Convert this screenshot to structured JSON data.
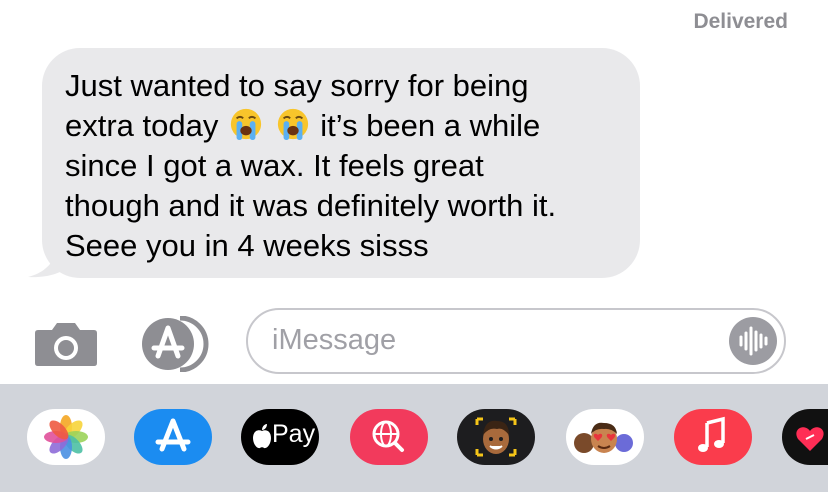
{
  "thread": {
    "status": "Delivered",
    "message": {
      "lines": [
        "Just wanted to say sorry for being",
        "extra today",
        "it’s been a while",
        "since I got a wax. It feels great",
        "though and it was definitely worth it.",
        "Seee you in 4 weeks sisss"
      ],
      "emoji": [
        "crying-face",
        "crying-face"
      ]
    }
  },
  "composer": {
    "placeholder": "iMessage",
    "camera_icon": "camera-icon",
    "apps_icon": "app-store-icon",
    "audio_icon": "audio-waveform-icon"
  },
  "app_drawer": {
    "apple_pay_label": "Pay",
    "apps": [
      "photos",
      "app-store",
      "apple-pay",
      "web-search",
      "memoji",
      "memoji-stickers",
      "music",
      "digital-touch"
    ]
  }
}
